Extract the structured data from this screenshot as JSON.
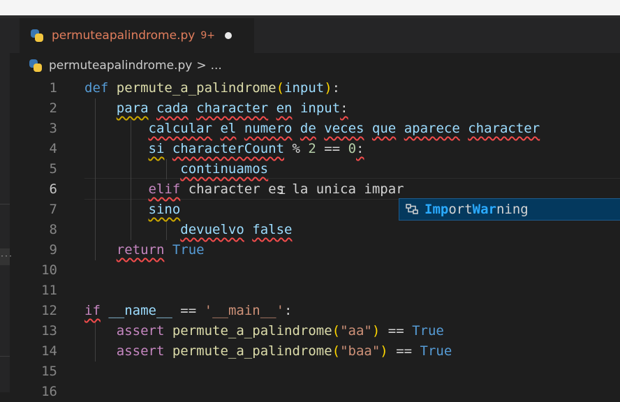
{
  "tab": {
    "title": "permuteapalindrome.py",
    "badge": "9+",
    "icon": "python-icon"
  },
  "breadcrumb": {
    "file": "permuteapalindrome.py",
    "separator": ">",
    "more": "..."
  },
  "editor": {
    "active_line": 6,
    "line_numbers": [
      "1",
      "2",
      "3",
      "4",
      "5",
      "6",
      "7",
      "8",
      "9",
      "10",
      "11",
      "12",
      "13",
      "14",
      "15",
      "16"
    ],
    "lines": [
      "def permute_a_palindrome(input):",
      "para cada character en input:",
      "calcular el numero de veces que aparece character",
      "si characterCount % 2 == 0:",
      "continuamos",
      "elif character es la unica impar",
      "sino",
      "devuelvo false",
      "return True",
      "",
      "",
      "if __name__ == '__main__':",
      "assert permute_a_palindrome(\"aa\") == True",
      "assert permute_a_palindrome(\"baa\") == True",
      "",
      ""
    ]
  },
  "suggestion": {
    "label": "ImportWarning",
    "icon": "class-icon",
    "match_color": "#2aaaff"
  },
  "colors": {
    "background": "#1e1e1e",
    "keyword": "#569cd6",
    "control": "#c586c0",
    "function": "#dcdcaa",
    "variable": "#9cdcfe",
    "string": "#ce9178",
    "error": "#f14c4c"
  }
}
